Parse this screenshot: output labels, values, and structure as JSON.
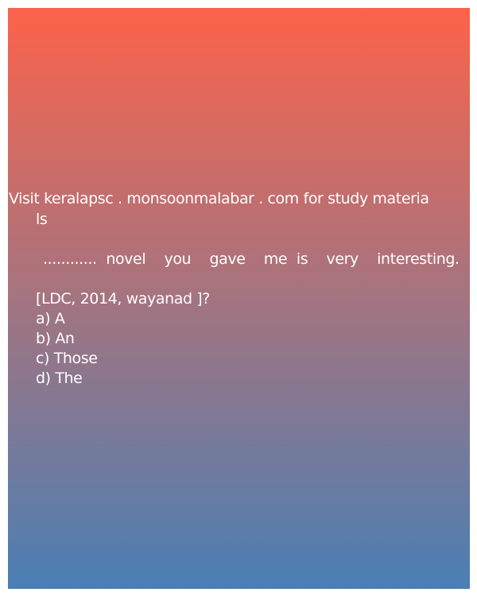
{
  "header": {
    "line1": "Visit keralapsc . monsoonmalabar . com for study materia",
    "line2": "ls"
  },
  "question": {
    "text": "............ novel  you  gave  me is  very  interesting."
  },
  "source": "[LDC, 2014, wayanad ]?",
  "options": [
    {
      "label": "a) A"
    },
    {
      "label": "b) An"
    },
    {
      "label": "c) Those"
    },
    {
      "label": "d) The"
    }
  ],
  "colors": {
    "gradient_top": "#fc634a",
    "gradient_middle": "#a47480",
    "gradient_bottom": "#4a7fb4",
    "text": "#ffffff"
  }
}
